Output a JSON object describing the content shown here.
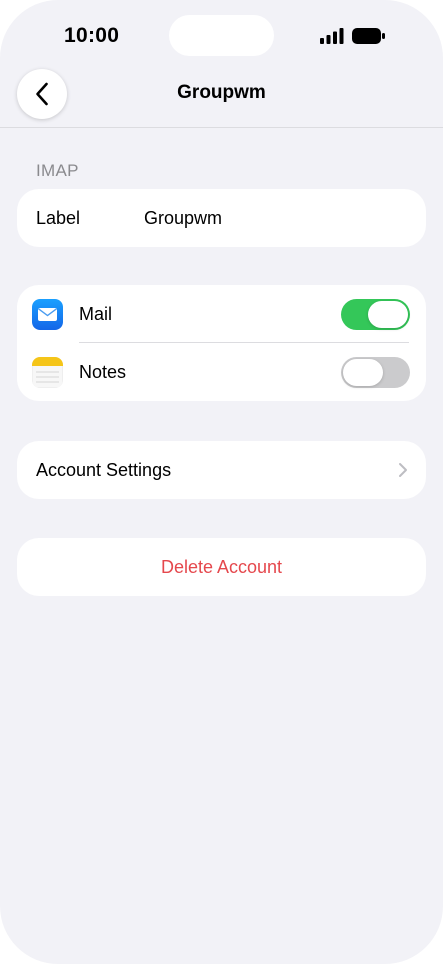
{
  "status_bar": {
    "time": "10:00"
  },
  "nav": {
    "title": "Groupwm"
  },
  "imap_section": {
    "header": "IMAP",
    "label_key": "Label",
    "label_value": "Groupwm"
  },
  "sync": {
    "items": [
      {
        "name": "Mail",
        "icon": "mail-icon",
        "enabled": true
      },
      {
        "name": "Notes",
        "icon": "notes-icon",
        "enabled": false
      }
    ]
  },
  "account_settings": {
    "label": "Account Settings"
  },
  "delete_account": {
    "label": "Delete Account"
  },
  "colors": {
    "background": "#f2f2f7",
    "toggle_on": "#34c759",
    "toggle_off": "#cbcbcd",
    "destructive": "#e5484d",
    "secondary_text": "#8a8a8e"
  }
}
